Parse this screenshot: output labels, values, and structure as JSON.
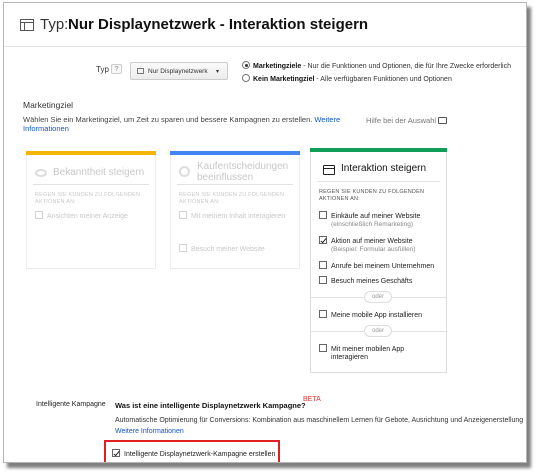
{
  "header": {
    "typ_label": "Typ:",
    "title": "Nur Displaynetzwerk - Interaktion steigern"
  },
  "type_selector": {
    "label": "Typ",
    "help": "?",
    "dropdown_value": "Nur Displaynetzwerk"
  },
  "goal_radio": {
    "option1_bold": "Marketingziele",
    "option1_rest": " - Nur die Funktionen und Optionen, die für Ihre Zwecke erforderlich",
    "option2_bold": "Kein Marketingziel",
    "option2_rest": " - Alle verfügbaren Funktionen und Optionen"
  },
  "marketing": {
    "title": "Marketingziel",
    "desc": "Wählen Sie ein Marketingziel, um Zeit zu sparen und bessere Kampagnen zu erstellen.",
    "desc_link": "Weitere Informationen",
    "help_text": "Hilfe bei der Auswahl"
  },
  "cards": {
    "awareness": {
      "title": "Bekanntheit steigern",
      "caption": "Regen Sie Kunden zu folgenden Aktionen an:",
      "option": "Ansichten meiner Anzeige"
    },
    "consideration": {
      "title_line1": "Kaufentscheidungen",
      "title_line2": "beeinflussen",
      "caption": "Regen Sie Kunden zu folgenden Aktionen an:",
      "option1": "Mit meinem Inhalt interagieren",
      "option2": "Besuch meiner Website"
    },
    "action": {
      "title": "Interaktion steigern",
      "caption": "Regen Sie Kunden zu folgenden Aktionen an:",
      "options": [
        {
          "label": "Einkäufe auf meiner Website",
          "sub": "(einschließlich Remarketing)",
          "checked": false
        },
        {
          "label": "Aktion auf meiner Website",
          "sub": "(Beispiel: Formular ausfüllen)",
          "checked": true
        },
        {
          "label": "Anrufe bei meinem Unternehmen",
          "sub": "",
          "checked": false
        },
        {
          "label": "Besuch meines Geschäfts",
          "sub": "",
          "checked": false
        }
      ],
      "oder1": "oder",
      "app_install": "Meine mobile App installieren",
      "oder2": "oder",
      "app_engage_line1": "Mit meiner mobilen App",
      "app_engage_line2": "interagieren"
    }
  },
  "smart": {
    "label": "Intelligente Kampagne",
    "question": "Was ist eine intelligente Displaynetzwerk Kampagne?",
    "beta": "BETA",
    "desc": "Automatische Optimierung für Conversions: Kombination aus maschinellem Lernen für Gebote, Ausrichtung und Anzeigenerstellung",
    "link": "Weitere Informationen",
    "checkbox_label": "Intelligente Displaynetzwerk-Kampagne erstellen",
    "checkbox_checked": true
  },
  "colors": {
    "awareness": "#f4b400",
    "consideration": "#4285f4",
    "action": "#0f9d58",
    "highlight": "#e02020",
    "link": "#1155cc"
  }
}
